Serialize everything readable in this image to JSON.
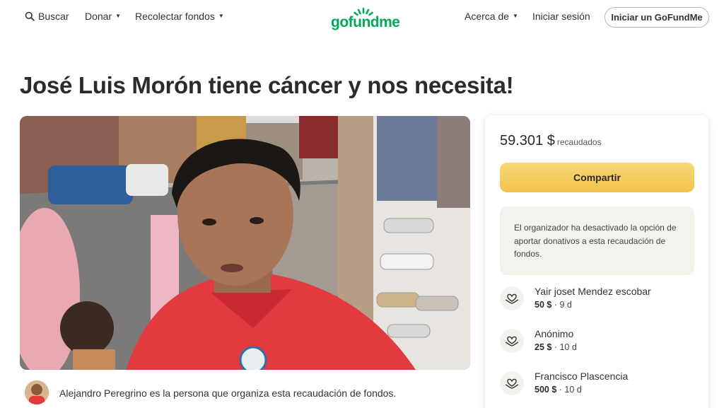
{
  "header": {
    "search_label": "Buscar",
    "donate_label": "Donar",
    "fundraise_label": "Recolectar fondos",
    "logo_text": "gofundme",
    "about_label": "Acerca de",
    "login_label": "Iniciar sesión",
    "signup_label": "Iniciar un GoFundMe"
  },
  "campaign": {
    "title": "José Luis Morón tiene cáncer y nos necesita!",
    "organizer_text": "Alejandro Peregrino es la persona que organiza esta recaudación de fondos."
  },
  "donation_card": {
    "amount_raised": "59.301 $",
    "raised_label": "recaudados",
    "share_label": "Compartir",
    "notice_text": "El organizador ha desactivado la opción de aportar donativos a esta recaudación de fondos.",
    "donors": [
      {
        "name": "Yair joset Mendez escobar",
        "amount": "50 $",
        "time": "· 9 d"
      },
      {
        "name": "Anónimo",
        "amount": "25 $",
        "time": "· 10 d"
      },
      {
        "name": "Francisco Plascencia",
        "amount": "500 $",
        "time": "· 10 d"
      }
    ]
  },
  "colors": {
    "brand_green": "#02a95c",
    "share_button": "#f4c752",
    "notice_background": "#f4f2ec"
  },
  "icons": {
    "search": "search-icon",
    "caret": "chevron-down-icon",
    "donor": "heart-hands-icon"
  }
}
